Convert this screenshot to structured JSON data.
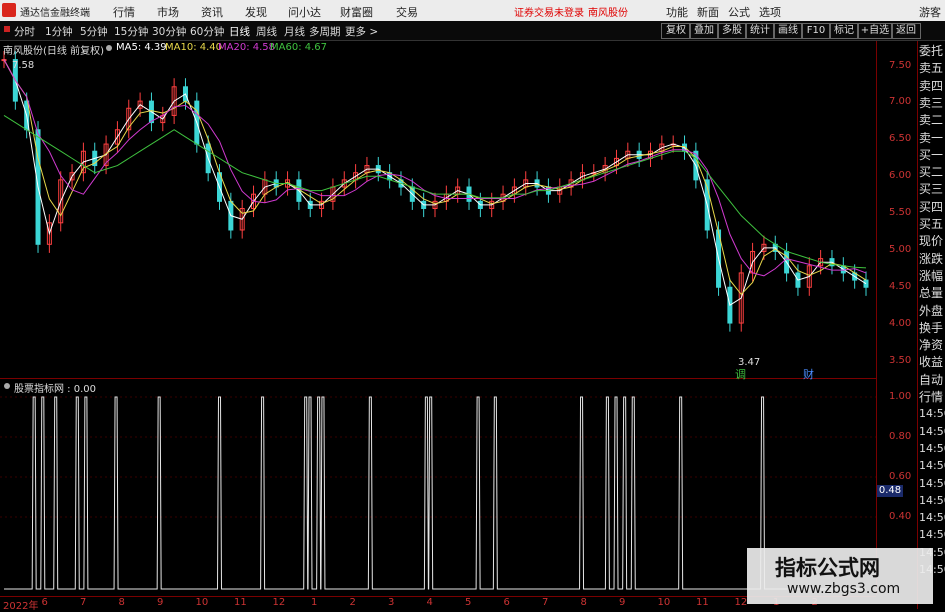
{
  "menubar": {
    "app_title": "通达信金融终端",
    "items": [
      "行情",
      "市场",
      "资讯",
      "发现",
      "问小达",
      "财富圈",
      "交易"
    ],
    "warning": "证券交易未登录",
    "stock_name": "南风股份",
    "right_items": [
      "功能",
      "新面",
      "公式",
      "选项"
    ],
    "user": "游客"
  },
  "tabs": {
    "items": [
      "分时",
      "1分钟",
      "5分钟",
      "15分钟",
      "30分钟",
      "60分钟",
      "日线",
      "周线",
      "月线",
      "多周期",
      "更多 >"
    ],
    "active": "日线",
    "right_buttons": [
      "复权",
      "叠加",
      "多股",
      "统计",
      "画线",
      "F10",
      "标记",
      "+自选",
      "返回"
    ]
  },
  "main_chart": {
    "title": "南风股份(日线 前复权)",
    "ma": [
      {
        "label": "MA5: 4.39",
        "color": "#ffffff"
      },
      {
        "label": "MA10: 4.40",
        "color": "#e8d84a"
      },
      {
        "label": "MA20: 4.58",
        "color": "#d03ad0"
      },
      {
        "label": "MA60: 4.67",
        "color": "#3fc23f"
      }
    ],
    "high_label": "7.58",
    "low_label": "3.47",
    "marker1": "调",
    "marker2": "财"
  },
  "chart_data": {
    "type": "line",
    "price_ticks": [
      "7.50",
      "7.00",
      "6.50",
      "6.00",
      "5.50",
      "5.00",
      "4.50",
      "4.00",
      "3.50"
    ],
    "ylim": [
      3.3,
      7.7
    ],
    "close": [
      7.58,
      7.0,
      6.6,
      5.0,
      5.3,
      5.9,
      6.0,
      6.3,
      6.1,
      6.4,
      6.6,
      6.9,
      7.0,
      6.7,
      6.8,
      7.2,
      7.0,
      6.4,
      6.0,
      5.6,
      5.2,
      5.5,
      5.7,
      5.9,
      5.8,
      5.9,
      5.6,
      5.5,
      5.6,
      5.8,
      5.9,
      6.0,
      6.1,
      6.0,
      5.9,
      5.8,
      5.6,
      5.5,
      5.6,
      5.7,
      5.8,
      5.6,
      5.5,
      5.6,
      5.7,
      5.8,
      5.9,
      5.8,
      5.7,
      5.8,
      5.9,
      6.0,
      6.0,
      6.1,
      6.2,
      6.3,
      6.2,
      6.3,
      6.4,
      6.4,
      6.3,
      5.9,
      5.2,
      4.4,
      3.9,
      4.6,
      4.9,
      5.0,
      4.9,
      4.6,
      4.4,
      4.7,
      4.8,
      4.7,
      4.6,
      4.5,
      4.4
    ],
    "ma60": [
      6.8,
      6.7,
      6.6,
      6.5,
      6.4,
      6.3,
      6.2,
      6.1,
      6.0,
      6.05,
      6.1,
      6.2,
      6.3,
      6.4,
      6.5,
      6.6,
      6.5,
      6.4,
      6.3,
      6.2,
      6.1,
      6.0,
      5.95,
      5.9,
      5.85,
      5.85,
      5.8,
      5.75,
      5.75,
      5.8,
      5.85,
      5.9,
      5.95,
      5.95,
      5.9,
      5.85,
      5.8,
      5.75,
      5.7,
      5.7,
      5.7,
      5.7,
      5.65,
      5.65,
      5.65,
      5.7,
      5.7,
      5.75,
      5.75,
      5.8,
      5.85,
      5.9,
      5.95,
      6.0,
      6.05,
      6.1,
      6.15,
      6.2,
      6.25,
      6.3,
      6.3,
      6.2,
      6.0,
      5.8,
      5.6,
      5.4,
      5.25,
      5.1,
      5.0,
      4.9,
      4.85,
      4.8,
      4.75,
      4.72,
      4.7,
      4.68,
      4.67
    ],
    "indicator": {
      "title": "股票指标网 : 0.00",
      "ticks": [
        "1.00",
        "0.80",
        "0.60",
        "0.40"
      ],
      "current_value": "0.48",
      "signal_positions": [
        0.035,
        0.045,
        0.06,
        0.085,
        0.095,
        0.13,
        0.18,
        0.25,
        0.3,
        0.35,
        0.355,
        0.365,
        0.37,
        0.425,
        0.49,
        0.495,
        0.55,
        0.57,
        0.67,
        0.7,
        0.71,
        0.72,
        0.73,
        0.785,
        0.88
      ]
    },
    "dates": [
      "2022年",
      "6",
      "7",
      "8",
      "9",
      "10",
      "11",
      "12",
      "1",
      "2",
      "3",
      "4",
      "5",
      "6",
      "7",
      "8",
      "9",
      "10",
      "11",
      "12",
      "1",
      "2"
    ]
  },
  "side_labels": [
    "委托",
    "卖五",
    "卖四",
    "卖三",
    "卖二",
    "卖一",
    "买一",
    "买二",
    "买三",
    "买四",
    "买五",
    "现价",
    "涨跌",
    "涨幅",
    "总量",
    "外盘",
    "换手",
    "净资",
    "收益",
    "自动",
    "行情",
    "14:50",
    "14:50",
    "14:50",
    "14:50",
    "14:50",
    "14:50",
    "14:50",
    "14:50",
    "14:50",
    "14:50"
  ],
  "watermark": {
    "line1": "指标公式网",
    "line2": "www.zbgs3.com"
  }
}
